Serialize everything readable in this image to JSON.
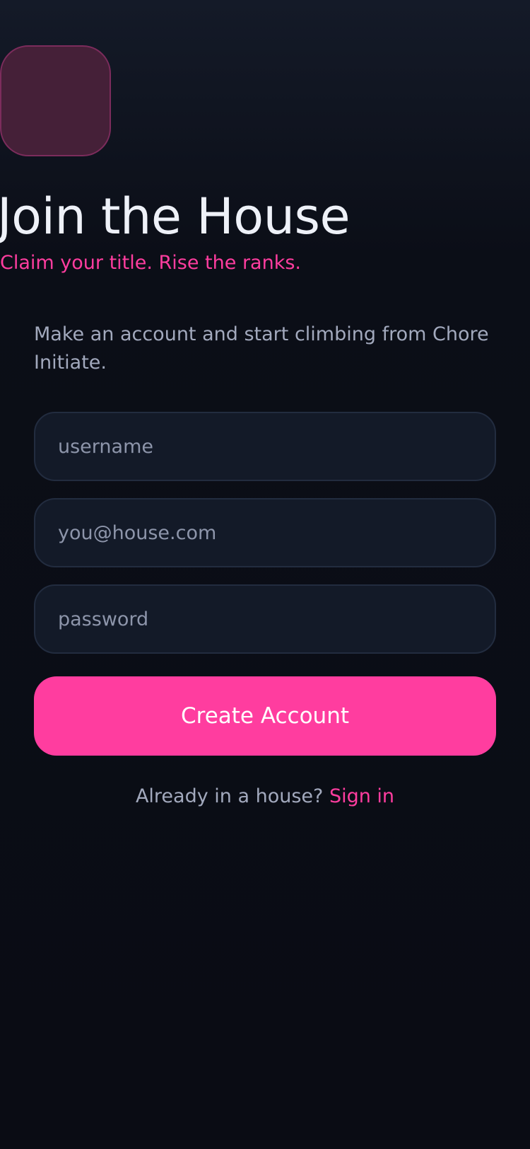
{
  "header": {
    "logo": "app-logo-tile",
    "title": "Join the House",
    "tagline": "Claim your title. Rise the ranks."
  },
  "intro": {
    "text": "Make an account and start climbing from Chore Initiate."
  },
  "form": {
    "username_placeholder": "username",
    "username_value": "",
    "email_placeholder": "you@house.com",
    "email_value": "",
    "password_placeholder": "password",
    "password_value": "",
    "submit_label": "Create Account"
  },
  "footer": {
    "prompt": "Already in a house? ",
    "signin_label": "Sign in"
  },
  "colors": {
    "background": "#0b0e17",
    "accent": "#ff3d9f",
    "field_background": "#131a28",
    "title": "#eef1f8",
    "muted_text": "#a2a9bd"
  }
}
